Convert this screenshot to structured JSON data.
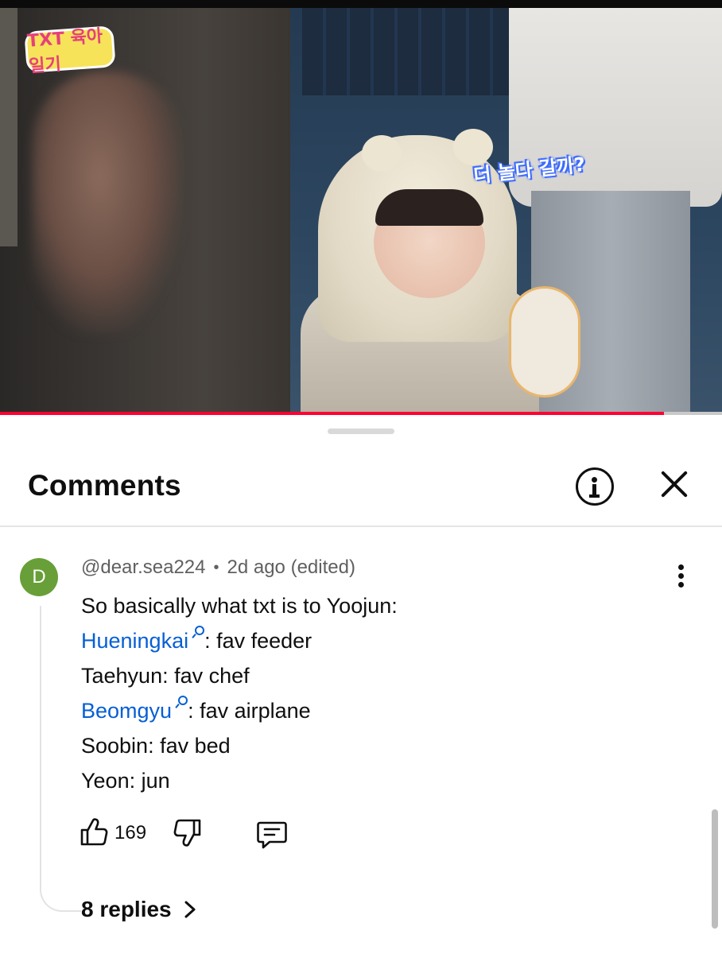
{
  "video": {
    "logo_text": "TXT 육아일기",
    "caption_text": "더 놀다 갈까?",
    "progress": 0.92,
    "progress_color": "#ff0033"
  },
  "comments_panel": {
    "title": "Comments",
    "info_icon": "info-icon",
    "close_icon": "close-icon"
  },
  "comment": {
    "avatar_letter": "D",
    "avatar_color": "#689f38",
    "author": "@dear.sea224",
    "separator": "•",
    "time": "2d ago (edited)",
    "lines": [
      {
        "mention": "",
        "text": "So basically what txt is to Yoojun:"
      },
      {
        "mention": "Hueningkai",
        "text": ": fav feeder"
      },
      {
        "mention": "",
        "text": "Taehyun: fav chef"
      },
      {
        "mention": "Beomgyu",
        "text": ": fav airplane"
      },
      {
        "mention": "",
        "text": "Soobin: fav bed"
      },
      {
        "mention": "",
        "text": "Yeon: jun"
      }
    ],
    "like_count": "169",
    "replies_label": "8 replies",
    "mention_color": "#065fd4"
  }
}
